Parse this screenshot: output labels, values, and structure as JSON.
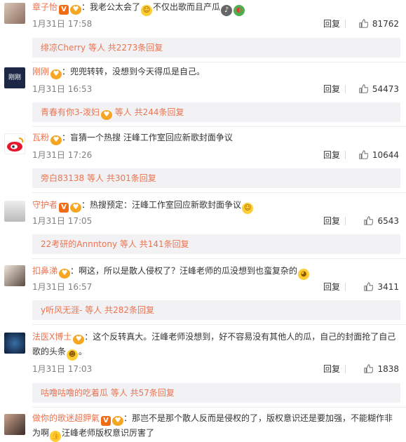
{
  "comments": [
    {
      "user": "章子怡",
      "badges": [
        "V",
        "fan"
      ],
      "text": "我老公太会了",
      "emoji_after": [
        "grin",
        "mic",
        "watermelon"
      ],
      "text_after": "不仅出歌而且产瓜",
      "date": "1月31日 17:58",
      "reply_label": "回复",
      "likes": "81762",
      "reply_summary_user": "绯凉Cherry",
      "reply_summary_rest": " 等人 共2273条回复"
    },
    {
      "user": "刚刚",
      "badges": [
        "fan"
      ],
      "text": "兜兜转转，没想到今天得瓜是自己。",
      "date": "1月31日 16:53",
      "reply_label": "回复",
      "likes": "54473",
      "reply_summary_user": "青春有你3-泼妇",
      "reply_summary_rest": " 等人 共244条回复"
    },
    {
      "user": "瓦粉",
      "badges": [
        "fan"
      ],
      "text": "盲猜一个热搜 汪峰工作室回应新歌封面争议",
      "date": "1月31日 17:26",
      "reply_label": "回复",
      "likes": "10644",
      "reply_summary_user": "旁白83138",
      "reply_summary_rest": " 等人 共301条回复"
    },
    {
      "user": "守护者",
      "badges": [
        "V",
        "fan"
      ],
      "text": "热搜预定：汪峰工作室回应新歌封面争议",
      "date": "1月31日 17:05",
      "reply_label": "回复",
      "likes": "6543",
      "reply_summary_user": "22考研的Annntony",
      "reply_summary_rest": " 等人 共141条回复"
    },
    {
      "user": "扣鼻涕",
      "badges": [
        "fan"
      ],
      "text": "啊这，所以是散人侵权了？汪峰老师的瓜没想到也蛮复杂的",
      "date": "1月31日 16:57",
      "reply_label": "回复",
      "likes": "3411",
      "reply_summary_user": "y听风无涯-",
      "reply_summary_rest": " 等人 共282条回复"
    },
    {
      "user": "法医X博士",
      "badges": [
        "fan"
      ],
      "text": "这个反转真大。汪峰老师没想到，好不容易没有其他人的瓜，自己的封面抢了自己歌的头条",
      "date": "1月31日 17:03",
      "reply_label": "回复",
      "likes": "1838",
      "reply_summary_user": "咕噜咕噜的吃着瓜",
      "reply_summary_rest": " 等人 共57条回复"
    },
    {
      "user": "做你的歌迷超鉀氣",
      "badges": [
        "V",
        "fan"
      ],
      "text": "那岂不是那个散人反而是侵权的了，版权意识还是要加强，不能糊作非为啊",
      "text_after": "汪峰老师版权意识厉害了"
    }
  ]
}
